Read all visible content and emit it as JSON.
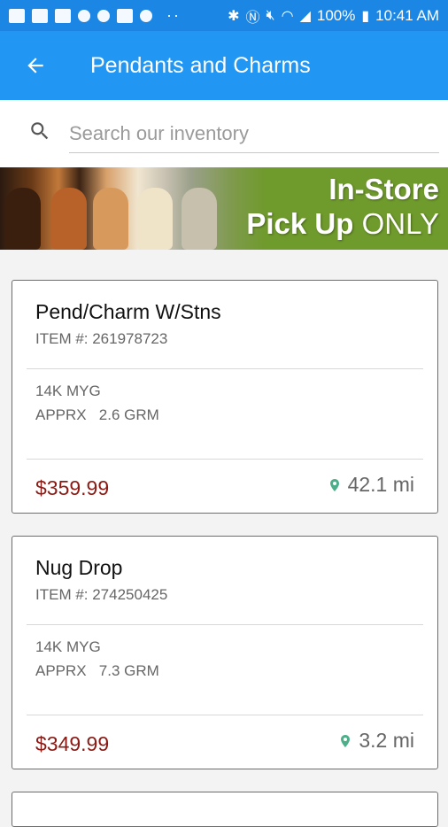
{
  "status_bar": {
    "battery": "100%",
    "time": "10:41 AM"
  },
  "app_bar": {
    "title": "Pendants and Charms"
  },
  "search": {
    "placeholder": "Search our inventory"
  },
  "banner": {
    "line1": "In-Store",
    "line2a": "Pick Up",
    "line2b": "ONLY"
  },
  "items": [
    {
      "name": "Pend/Charm W/Stns",
      "item_no": "ITEM #: 261978723",
      "desc1": "14K MYG",
      "desc2": "APPRX   2.6 GRM",
      "price": "$359.99",
      "distance": "42.1 mi"
    },
    {
      "name": "Nug Drop",
      "item_no": "ITEM #: 274250425",
      "desc1": "14K MYG",
      "desc2": "APPRX   7.3 GRM",
      "price": "$349.99",
      "distance": "3.2 mi"
    }
  ],
  "colors": {
    "app_bar": "#2196f3",
    "status_bar": "#1c86e4",
    "price": "#8b1a14",
    "pin": "#4caf8a"
  }
}
